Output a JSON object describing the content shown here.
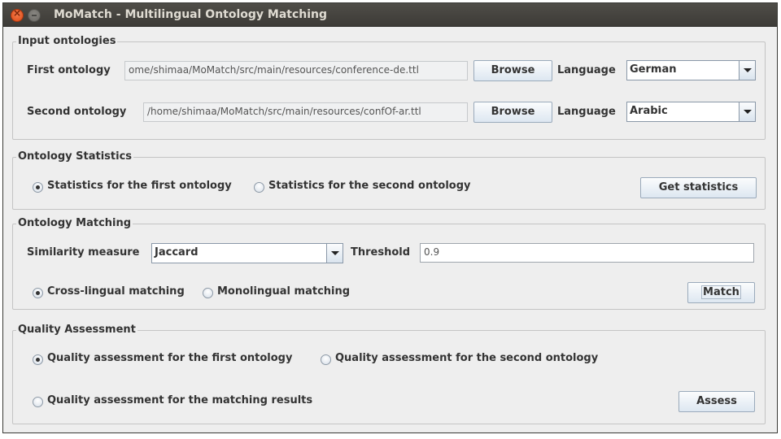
{
  "window": {
    "title": "MoMatch - Multilingual Ontology Matching",
    "controls": [
      "close",
      "minimize"
    ]
  },
  "input_ontologies": {
    "title": "Input ontologies",
    "first": {
      "label": "First ontology",
      "path": "ome/shimaa/MoMatch/src/main/resources/conference-de.ttl",
      "browse_label": "Browse",
      "language_label": "Language",
      "language": "German"
    },
    "second": {
      "label": "Second ontology",
      "path": "/home/shimaa/MoMatch/src/main/resources/confOf-ar.ttl",
      "browse_label": "Browse",
      "language_label": "Language",
      "language": "Arabic"
    }
  },
  "statistics": {
    "title": "Ontology Statistics",
    "options": [
      {
        "label": "Statistics for the first ontology",
        "checked": true
      },
      {
        "label": "Statistics for the second ontology",
        "checked": false
      }
    ],
    "button_label": "Get statistics"
  },
  "matching": {
    "title": "Ontology Matching",
    "similarity_label": "Similarity measure",
    "similarity_value": "Jaccard",
    "threshold_label": "Threshold",
    "threshold_value": "0.9",
    "options": [
      {
        "label": "Cross-lingual matching",
        "checked": true
      },
      {
        "label": "Monolingual matching",
        "checked": false
      }
    ],
    "button_label": "Match"
  },
  "quality": {
    "title": "Quality Assessment",
    "options": [
      {
        "label": "Quality assessment for the first ontology",
        "checked": true
      },
      {
        "label": "Quality assessment for the second ontology",
        "checked": false
      },
      {
        "label": "Quality assessment for the matching results",
        "checked": false
      }
    ],
    "button_label": "Assess"
  }
}
